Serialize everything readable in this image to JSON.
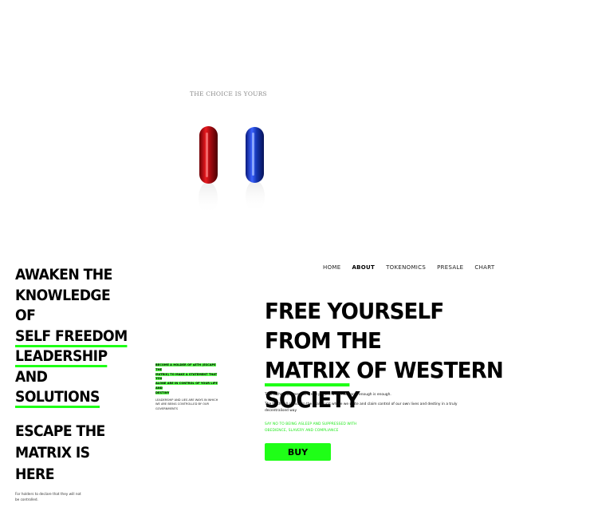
{
  "hero_top": {
    "tagline": "THE CHOICE IS YOURS"
  },
  "left": {
    "heading_line1": "AWAKEN THE",
    "heading_line2": "KNOWLEDGE OF",
    "heading_hl1": "SELF FREEDOM",
    "heading_hl2": "LEADERSHIP",
    "heading_and": "AND",
    "heading_hl3": "SOLUTIONS"
  },
  "mid_note": {
    "line_a": "BECOME A HOLDER OF $ETH (ESCAPE THE",
    "line_b": "MATRIX) TO MAKE A STATEMENT THAT YOU",
    "line_c": "ALONE ARE IN CONTROL OF YOUR LIFE AND",
    "line_d": "DESTINY",
    "line_e": "LEADERSHIP AND LIES ARE WAYS IN WHICH WE ARE BEING CONTROLLED BY OUR GOVERNMENTS"
  },
  "escape": {
    "line1": "ESCAPE THE",
    "line2": "MATRIX IS",
    "line3": "HERE",
    "sub": "For holders to declare that they will not be controlled."
  },
  "nav": {
    "home": "HOME",
    "about": "ABOUT",
    "tokenomics": "TOKENOMICS",
    "presale": "PRESALE",
    "chart": "CHART"
  },
  "hero": {
    "title_a": "FREE YOURSELF FROM THE",
    "title_hl": "MATRIX",
    "title_b": "OF WESTERN",
    "title_c": "SOCIETY",
    "p1": "This is the statement of a real project which declares enough is enough.",
    "p2": "The truth will prevail in the real world where we unite and claim control of our own lives and destiny in a truly decentralised way",
    "p3": "SAY NO TO BEING ASLEEP AND SUPPRESSED WITH OBEDIENCE, SLAVERY AND COMPLIANCE",
    "buy_label": "BUY"
  },
  "colors": {
    "accent_green": "#1fff17",
    "background": "#ffffff",
    "text": "#000000",
    "red_pill": "#c8151b",
    "blue_pill": "#1d3fd1"
  },
  "icons": {
    "hero_art": "red-and-blue-pill-icon"
  }
}
